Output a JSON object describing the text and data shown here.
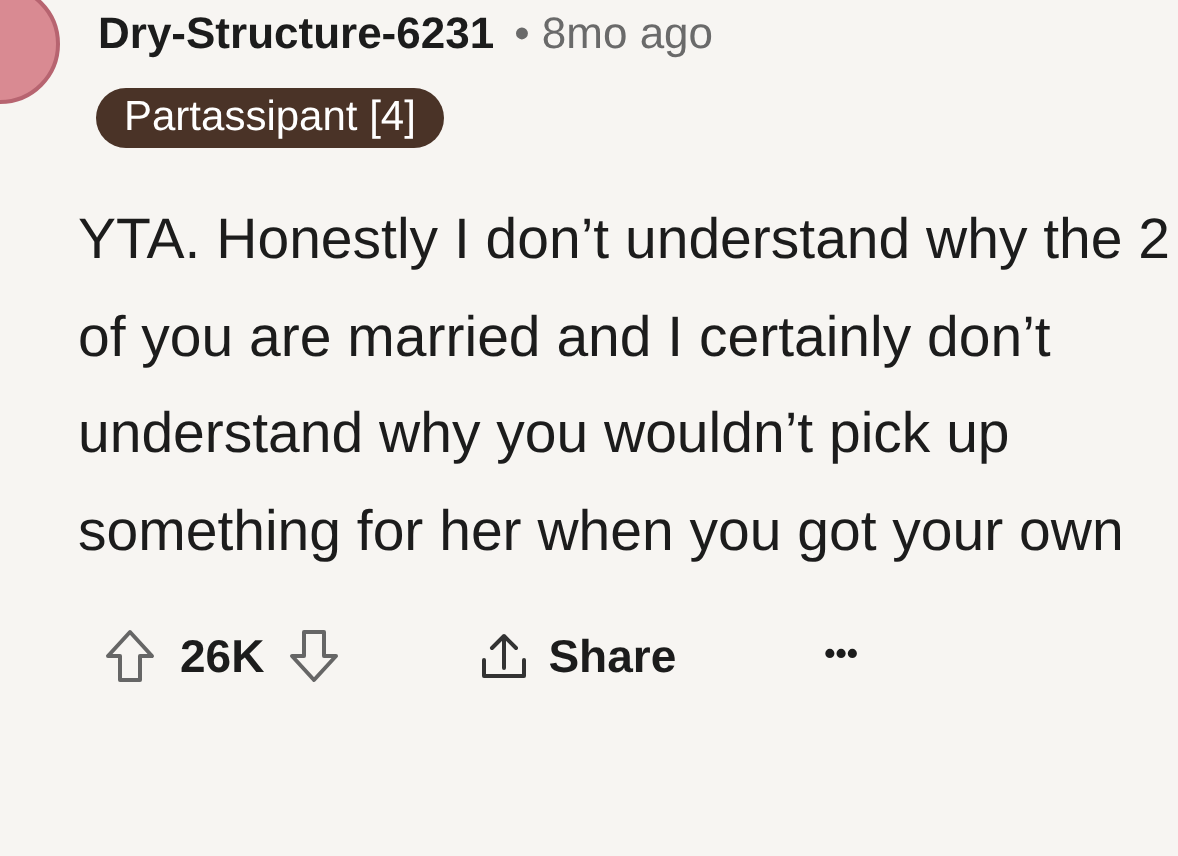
{
  "comment": {
    "author": "Dry-Structure-6231",
    "separator": "•",
    "time": "8mo ago",
    "flair": "Partassipant [4]",
    "body": "YTA. Honestly I don’t understand why the 2 of you are married and I certainly don’t understand why you wouldn’t pick up something for her when you got your own"
  },
  "actions": {
    "score": "26K",
    "share": "Share",
    "more": "•••"
  }
}
